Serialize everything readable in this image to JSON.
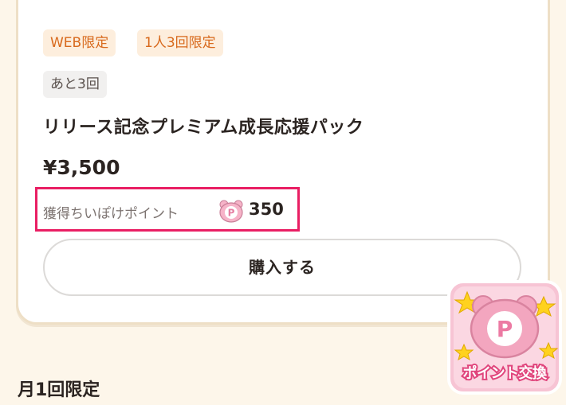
{
  "product": {
    "tags": [
      "WEB限定",
      "1人3回限定"
    ],
    "remaining": "あと3回",
    "title": "リリース記念プレミアム成長応援パック",
    "price": "¥3,500",
    "points_label": "獲得ちいぽけポイント",
    "points_icon": "point-coin-icon",
    "points_value": "350",
    "buy_label": "購入する"
  },
  "next_section": {
    "heading": "月1回限定"
  },
  "point_exchange_button": {
    "label": "ポイント交換",
    "icon": "bear-point-icon",
    "icon_letter": "P"
  },
  "colors": {
    "background": "#fdf6ea",
    "card_border": "#eedfc6",
    "tag_orange_bg": "#fdeedd",
    "tag_orange_text": "#d8691c",
    "tag_gray_bg": "#f1f0ef",
    "highlight_border": "#e91e63",
    "accent_pink": "#f08fb0"
  }
}
